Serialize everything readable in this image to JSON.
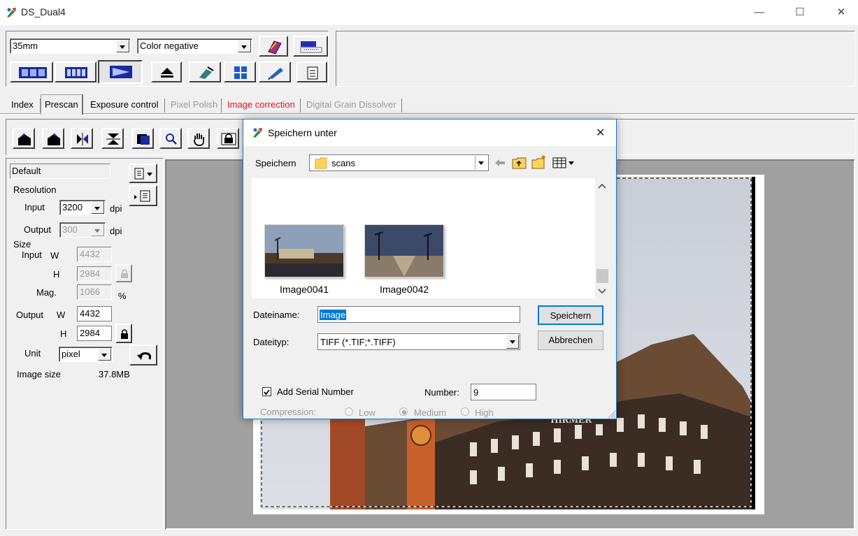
{
  "window": {
    "title": "DS_Dual4",
    "minimize": "—",
    "maximize": "☐",
    "close": "✕"
  },
  "toolbar": {
    "film_size": "35mm",
    "film_type": "Color negative"
  },
  "tabs": [
    {
      "label": "Index",
      "color": "#000000"
    },
    {
      "label": "Prescan",
      "color": "#000000"
    },
    {
      "label": "Exposure control",
      "color": "#000000"
    },
    {
      "label": "Pixel Polish",
      "color": "#9a9a9a"
    },
    {
      "label": "Image correction",
      "color": "#e81123"
    },
    {
      "label": "Digital Grain Dissolver",
      "color": "#9a9a9a"
    }
  ],
  "settings": {
    "preset": "Default",
    "resolution_label": "Resolution",
    "input_label": "Input",
    "input_dpi": "3200",
    "dpi_unit": "dpi",
    "output_label": "Output",
    "output_dpi": "300",
    "size_label": "Size",
    "size_input_label": "Input",
    "w_label": "W",
    "h_label": "H",
    "input_w": "4432",
    "input_h": "2984",
    "mag_label": "Mag.",
    "mag_value": "1066",
    "mag_unit": "%",
    "size_output_label": "Output",
    "output_w": "4432",
    "output_h": "2984",
    "unit_label": "Unit",
    "unit_value": "pixel",
    "image_size_label": "Image size",
    "image_size_value": "37.8MB"
  },
  "preview": {
    "sign_text": "HIRMER"
  },
  "dialog": {
    "title": "Speichern unter",
    "save_in_label": "Speichern",
    "folder": "scans",
    "files": [
      {
        "name": "Image0041"
      },
      {
        "name": "Image0042"
      }
    ],
    "filename_label": "Dateiname:",
    "filename_value": "Image",
    "filetype_label": "Dateityp:",
    "filetype_value": "TIFF (*.TIF;*.TIFF)",
    "save_button": "Speichern",
    "cancel_button": "Abbrechen",
    "serial_label": "Add Serial Number",
    "serial_checked": true,
    "number_label": "Number:",
    "number_value": "9",
    "compression_label": "Compression:",
    "compression_low": "Low",
    "compression_medium": "Medium",
    "compression_high": "High",
    "compression_selected": "Medium"
  }
}
